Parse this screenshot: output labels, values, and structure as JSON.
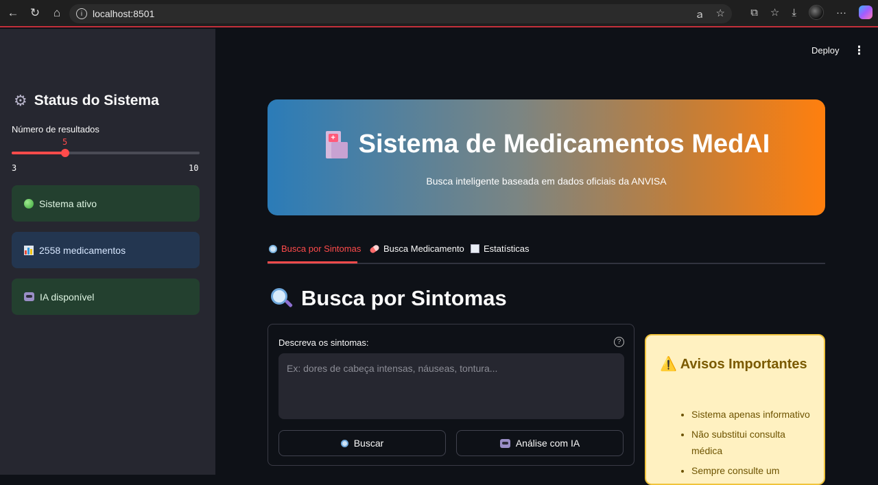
{
  "browser": {
    "url": "localhost:8501",
    "icons": [
      "back-icon",
      "reload-icon",
      "home-icon",
      "info-icon",
      "translate-icon",
      "star-icon",
      "extensions-icon",
      "favorites-icon",
      "download-icon",
      "profile-avatar",
      "more-icon",
      "copilot-icon"
    ]
  },
  "header": {
    "deploy_label": "Deploy",
    "menu_icon": "⋮"
  },
  "sidebar": {
    "title": "Status do Sistema",
    "slider": {
      "label": "Número de resultados",
      "value": 5,
      "min": 3,
      "max": 10,
      "value_text": "5",
      "min_text": "3",
      "max_text": "10"
    },
    "status": [
      {
        "text": "Sistema ativo",
        "icon": "green-circle-icon"
      },
      {
        "text": "2558 medicamentos",
        "icon": "bar-chart-icon"
      },
      {
        "text": "IA disponível",
        "icon": "robot-icon"
      }
    ]
  },
  "hero": {
    "title": "Sistema de Medicamentos MedAI",
    "subtitle": "Busca inteligente baseada em dados oficiais da ANVISA"
  },
  "tabs": [
    {
      "label": "Busca por Sintomas",
      "icon": "magnifier-icon",
      "active": true
    },
    {
      "label": "Busca Medicamento",
      "icon": "pill-icon",
      "active": false
    },
    {
      "label": "Estatísticas",
      "icon": "trend-chart-icon",
      "active": false
    }
  ],
  "section": {
    "title": "Busca por Sintomas"
  },
  "form": {
    "label": "Descreva os sintomas:",
    "placeholder": "Ex: dores de cabeça intensas, náuseas, tontura...",
    "value": "",
    "search_button": "Buscar",
    "ai_button": "Análise com IA"
  },
  "warnings": {
    "title": "Avisos Importantes",
    "icon": "⚠️",
    "items": [
      "Sistema apenas informativo",
      "Não substitui consulta médica",
      "Sempre consulte um"
    ]
  },
  "colors": {
    "accent": "#ff4b4b",
    "sidebar_bg": "#262730",
    "main_bg": "#0e1117",
    "success_bg": "#23402f",
    "info_bg": "#233650",
    "warning_bg": "#fff1c1",
    "hero_gradient_start": "#2b7cb8",
    "hero_gradient_end": "#ff7f0e"
  }
}
